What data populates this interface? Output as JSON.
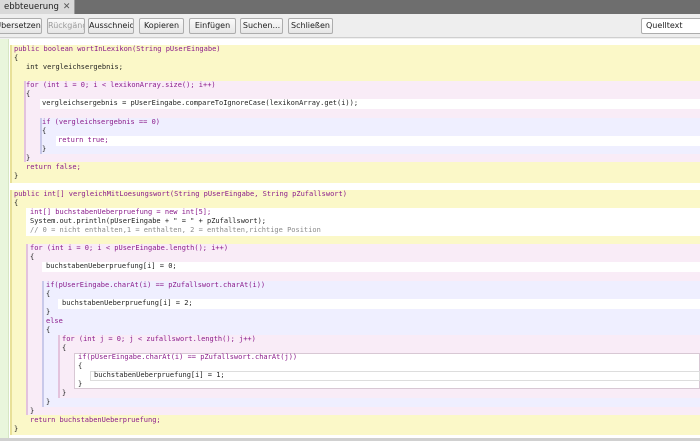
{
  "window": {
    "tab_label": "ebbteuerung",
    "close_glyph": "✕"
  },
  "toolbar": {
    "buttons": [
      {
        "label": "Übersetzen",
        "enabled": true
      },
      {
        "label": "Rückgängig",
        "enabled": false
      },
      {
        "label": "Ausschneiden",
        "enabled": true
      },
      {
        "label": "Kopieren",
        "enabled": true
      },
      {
        "label": "Einfügen",
        "enabled": true
      },
      {
        "label": "Suchen...",
        "enabled": true
      },
      {
        "label": "Schließen",
        "enabled": true
      }
    ],
    "view_select": "Quelltext"
  },
  "colors": {
    "method_block": "#fbf8c8",
    "for_block": "#f9ecf7",
    "if_block": "#efefff",
    "nested_block": "#ffffff",
    "gutter": "#e9f6dc"
  },
  "code": {
    "lines": [
      {
        "text": "public boolean wortInLexikon(String pUserEingabe)",
        "kind": "kw"
      },
      {
        "text": "{",
        "kind": "plain"
      },
      {
        "text": "int vergleichsergebnis;",
        "kind": "plain"
      },
      {
        "text": "for (int i = 0; i < lexikonArray.size(); i++)",
        "kind": "kw"
      },
      {
        "text": "{",
        "kind": "plain"
      },
      {
        "text": "vergleichsergebnis = pUserEingabe.compareToIgnoreCase(lexikonArray.get(i));",
        "kind": "plain"
      },
      {
        "text": "if (vergleichsergebnis == 0)",
        "kind": "kw"
      },
      {
        "text": "{",
        "kind": "plain"
      },
      {
        "text": "return true;",
        "kind": "kw"
      },
      {
        "text": "}",
        "kind": "plain"
      },
      {
        "text": "}",
        "kind": "plain"
      },
      {
        "text": "return false;",
        "kind": "kw"
      },
      {
        "text": "}",
        "kind": "plain"
      },
      {
        "text": "public int[] vergleichMitLoesungswort(String pUserEingabe, String pZufallswort)",
        "kind": "kw"
      },
      {
        "text": "{",
        "kind": "plain"
      },
      {
        "text": "int[] buchstabenUeberpruefung = new int[5];",
        "kind": "kw"
      },
      {
        "text": "System.out.println(pUserEingabe + \" = \" + pZufallswort);",
        "kind": "plain"
      },
      {
        "text": "// 0 = nicht enthalten,1 = enthalten, 2 = enthalten,richtige Position",
        "kind": "cm"
      },
      {
        "text": "for (int i = 0; i < pUserEingabe.length(); i++)",
        "kind": "kw"
      },
      {
        "text": "{",
        "kind": "plain"
      },
      {
        "text": "buchstabenUeberpruefung[i] = 0;",
        "kind": "plain"
      },
      {
        "text": "if(pUserEingabe.charAt(i) == pZufallswort.charAt(i))",
        "kind": "kw"
      },
      {
        "text": "{",
        "kind": "plain"
      },
      {
        "text": "buchstabenUeberpruefung[i] = 2;",
        "kind": "plain"
      },
      {
        "text": "}",
        "kind": "plain"
      },
      {
        "text": "else",
        "kind": "kw"
      },
      {
        "text": "{",
        "kind": "plain"
      },
      {
        "text": "for (int j = 0; j < zufallswort.length(); j++)",
        "kind": "kw"
      },
      {
        "text": "{",
        "kind": "plain"
      },
      {
        "text": "if(pUserEingabe.charAt(i) == pZufallswort.charAt(j))",
        "kind": "kw"
      },
      {
        "text": "{",
        "kind": "plain"
      },
      {
        "text": "buchstabenUeberpruefung[i] = 1;",
        "kind": "plain"
      },
      {
        "text": "}",
        "kind": "plain"
      },
      {
        "text": "}",
        "kind": "plain"
      },
      {
        "text": "}",
        "kind": "plain"
      },
      {
        "text": "}",
        "kind": "plain"
      },
      {
        "text": "return buchstabenUeberpruefung;",
        "kind": "kw"
      },
      {
        "text": "}",
        "kind": "plain"
      }
    ]
  }
}
